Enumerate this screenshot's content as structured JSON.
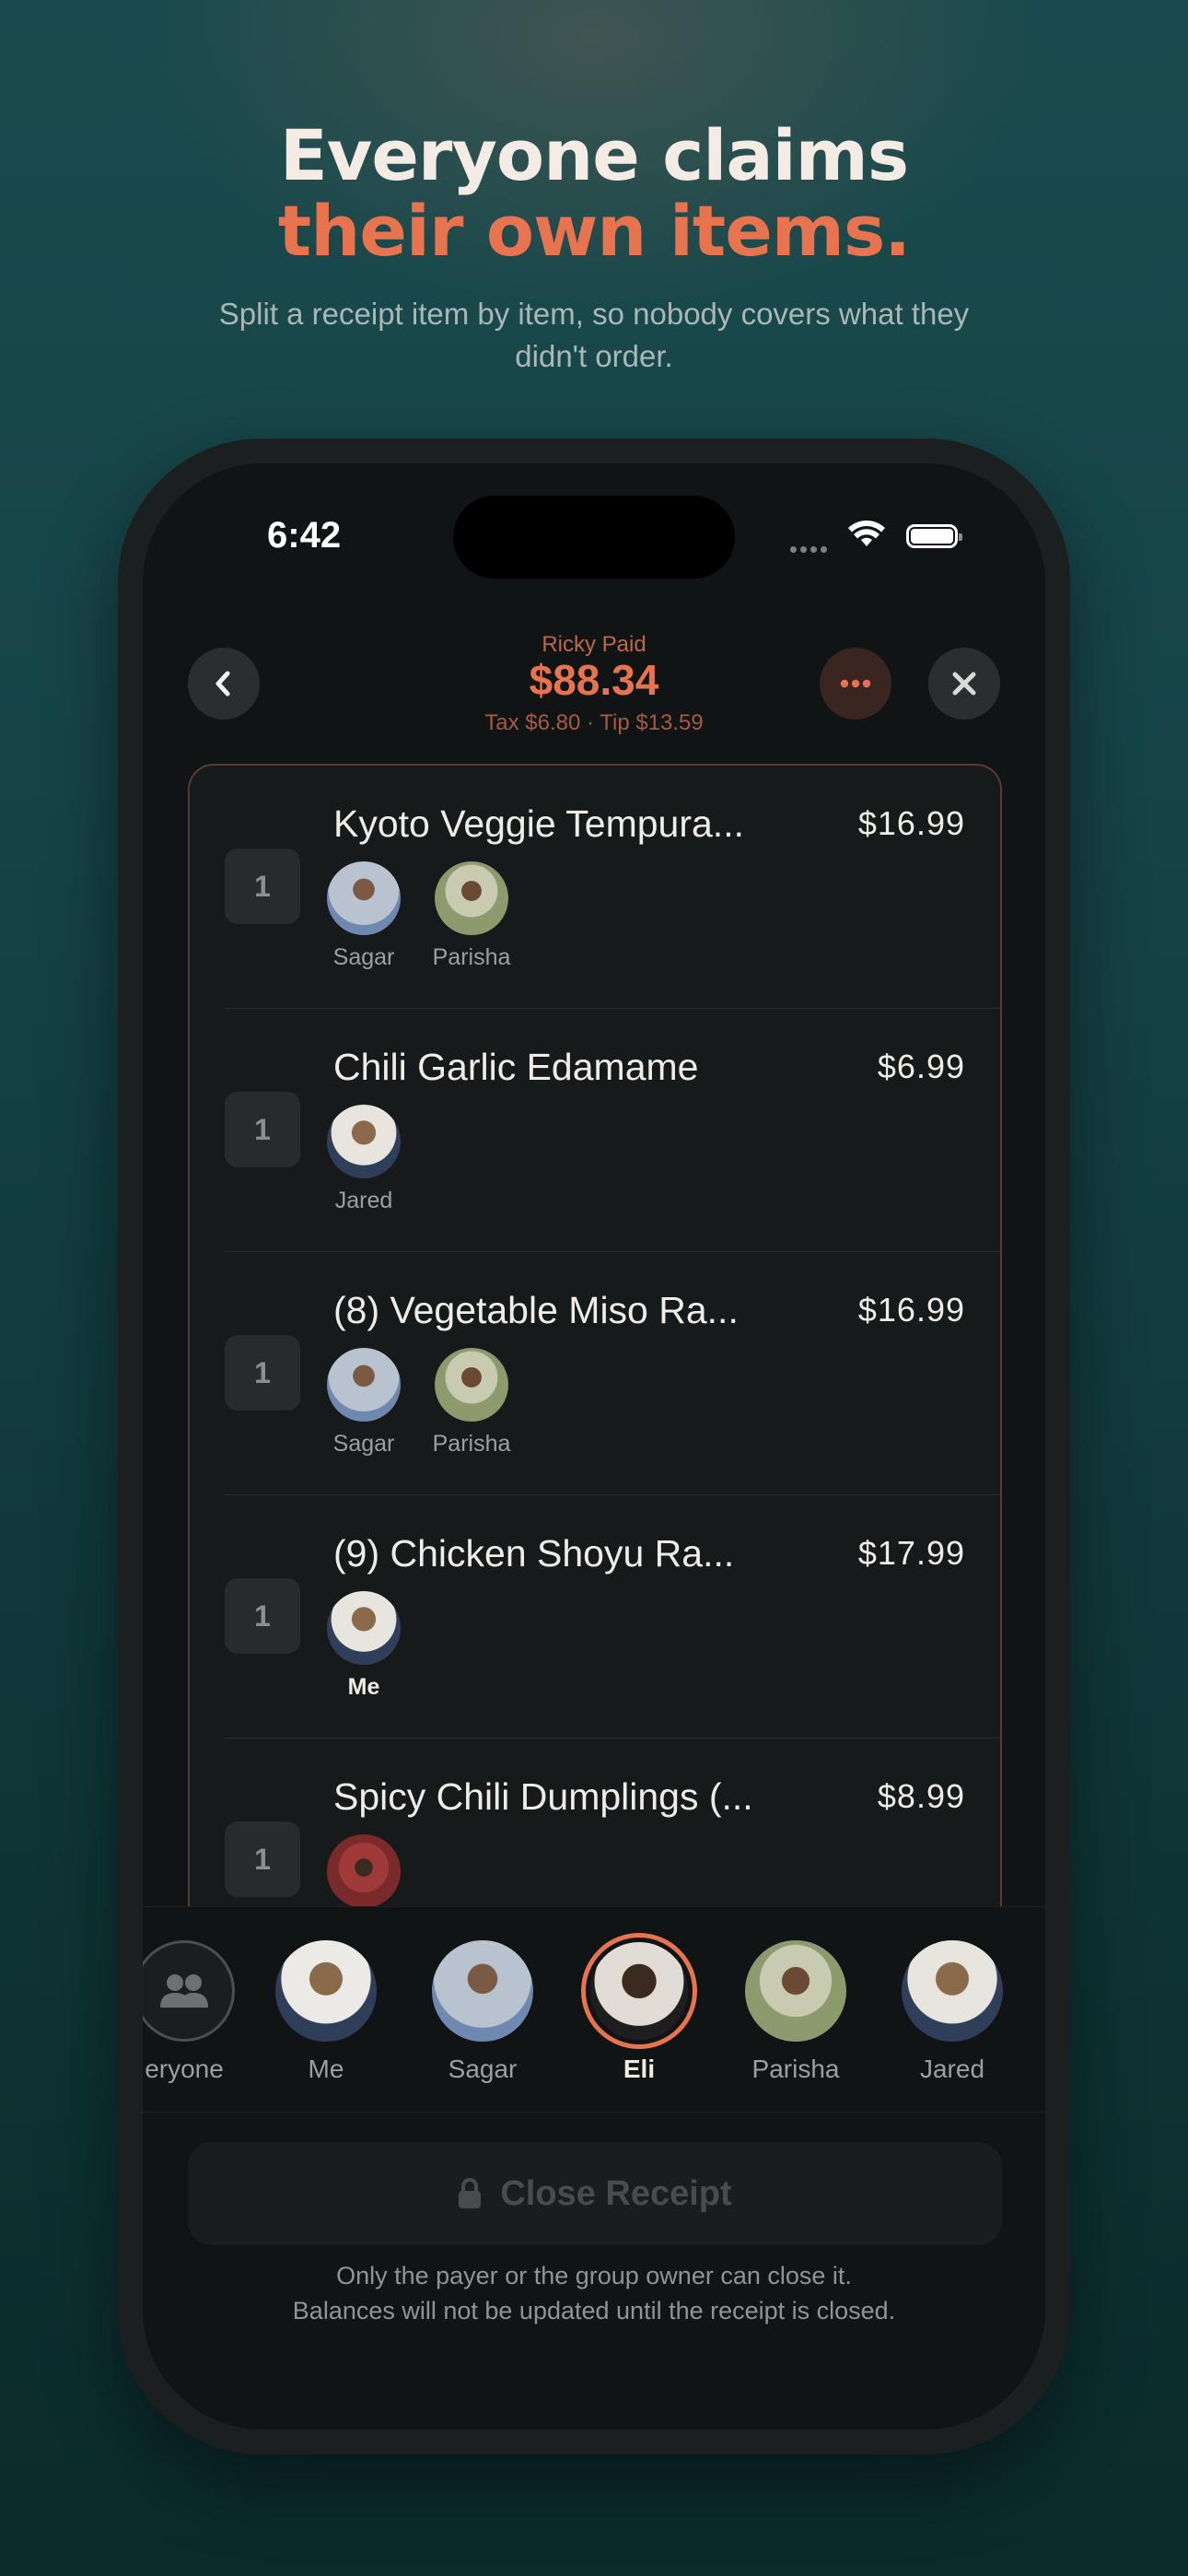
{
  "hero": {
    "line1": "Everyone claims",
    "line2": "their own items.",
    "subtitle": "Split a receipt item by item, so nobody covers what they didn't order."
  },
  "status": {
    "time": "6:42"
  },
  "header": {
    "payer_label": "Ricky Paid",
    "total": "$88.34",
    "tax_tip": "Tax $6.80  ·  Tip $13.59",
    "icons": {
      "back": "chevron-left-icon",
      "more": "ellipsis-icon",
      "close": "close-icon"
    }
  },
  "items": [
    {
      "qty": "1",
      "name": "Kyoto Veggie Tempura...",
      "price": "$16.99",
      "claimed_by": [
        {
          "name": "Sagar",
          "avatar": "#b9c3cf"
        },
        {
          "name": "Parisha",
          "avatar": "#9ea885"
        }
      ]
    },
    {
      "qty": "1",
      "name": "Chili Garlic Edamame",
      "price": "$6.99",
      "claimed_by": [
        {
          "name": "Jared",
          "avatar": "#c4b2a2"
        }
      ]
    },
    {
      "qty": "1",
      "name": "(8) Vegetable Miso Ra...",
      "price": "$16.99",
      "claimed_by": [
        {
          "name": "Sagar",
          "avatar": "#b9c3cf"
        },
        {
          "name": "Parisha",
          "avatar": "#9ea885"
        }
      ]
    },
    {
      "qty": "1",
      "name": "(9) Chicken Shoyu Ra...",
      "price": "$17.99",
      "claimed_by": [
        {
          "name": "Me",
          "avatar": "#c4b2a2"
        }
      ]
    },
    {
      "qty": "1",
      "name": "Spicy Chili Dumplings (...",
      "price": "$8.99",
      "claimed_by": [
        {
          "name": "",
          "avatar": "#8a3a3a"
        }
      ]
    }
  ],
  "people": [
    {
      "name": "eryone",
      "icon": "people-icon"
    },
    {
      "name": "Me",
      "avatar": "#c9b6a4"
    },
    {
      "name": "Sagar",
      "avatar": "#b9c3cf"
    },
    {
      "name": "Eli",
      "avatar": "#d8d2c8",
      "selected": true
    },
    {
      "name": "Parisha",
      "avatar": "#9ea885"
    },
    {
      "name": "Jared",
      "avatar": "#c4b2a2"
    }
  ],
  "footer": {
    "close_button": "Close Receipt",
    "lock_icon": "lock-icon",
    "note_line1": "Only the payer or the group owner can close it.",
    "note_line2": "Balances will not be updated until the receipt is closed."
  },
  "colors": {
    "accent": "#e8734f",
    "background": "#164447",
    "screen": "#101414"
  }
}
